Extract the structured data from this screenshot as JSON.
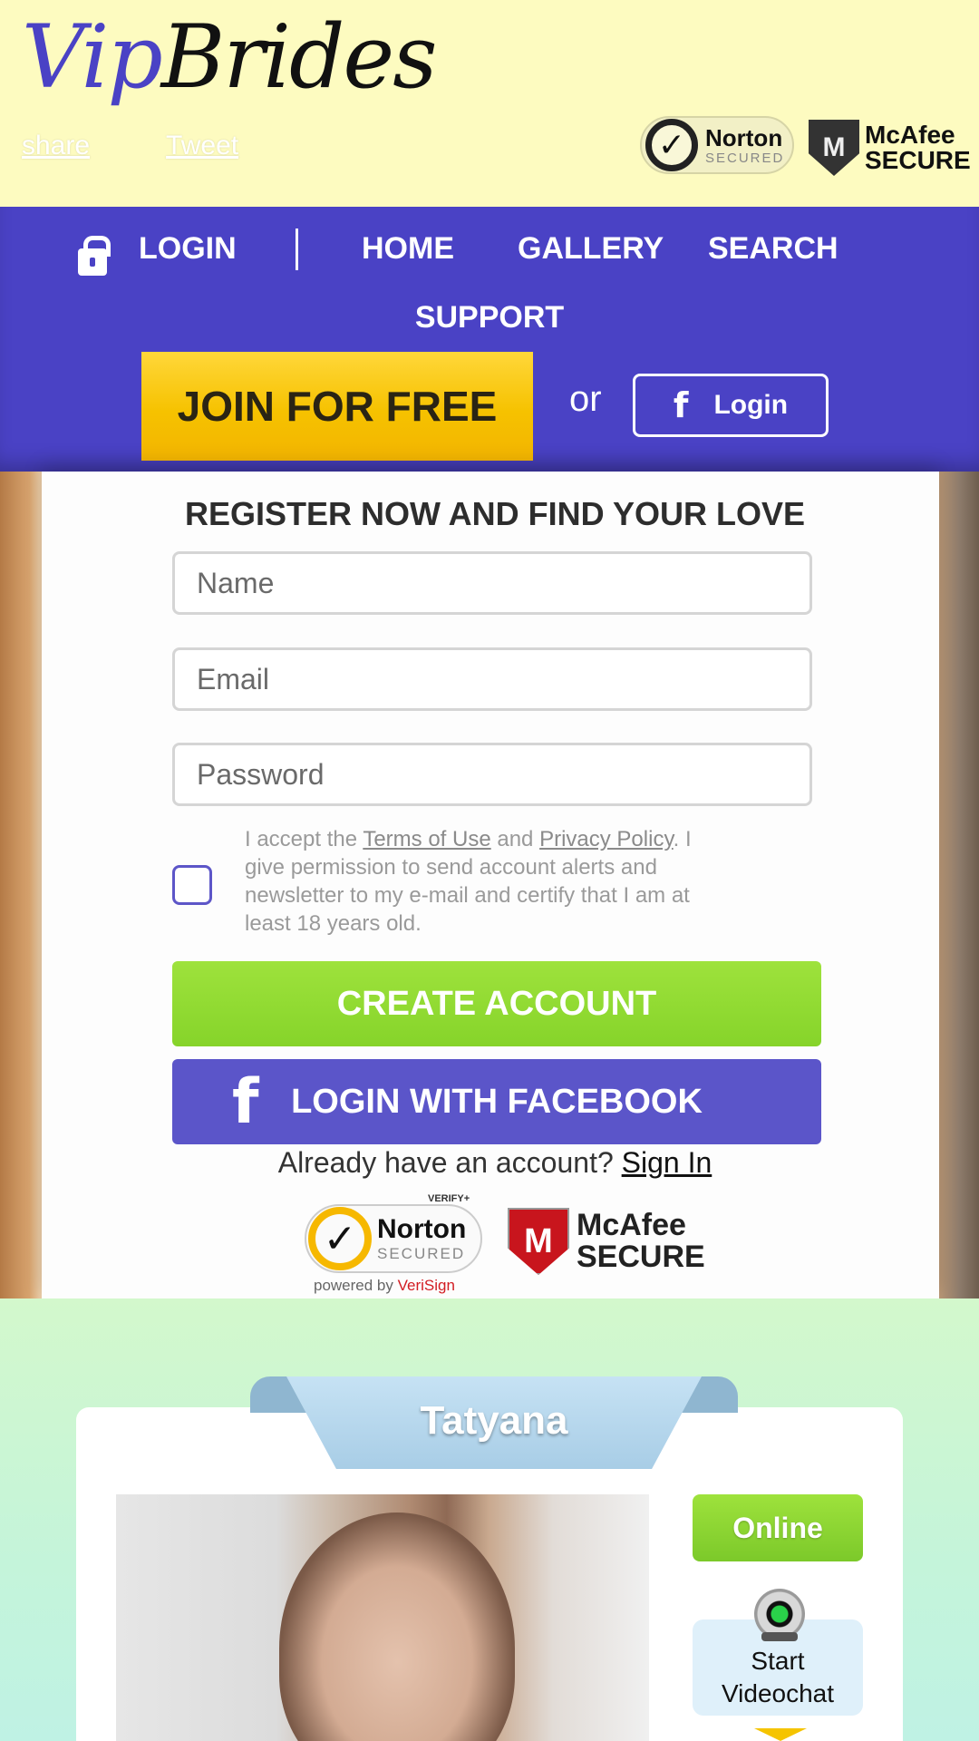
{
  "header": {
    "logo_part1": "Vip",
    "logo_part2": "Brides",
    "share_label": "share",
    "tweet_label": "Tweet",
    "norton_badge": {
      "line1": "Norton",
      "line2": "SECURED"
    },
    "mcafee_badge": {
      "shield": "M",
      "line1": "McAfee",
      "line2": "SECURE"
    }
  },
  "nav": {
    "login": "LOGIN",
    "home": "HOME",
    "gallery": "GALLERY",
    "search": "SEARCH",
    "support": "SUPPORT",
    "join_button": "JOIN FOR FREE",
    "or_text": "or",
    "fb_login_icon": "f",
    "fb_login_label": "Login"
  },
  "register": {
    "title": "REGISTER NOW AND FIND YOUR LOVE",
    "name_placeholder": "Name",
    "email_placeholder": "Email",
    "password_placeholder": "Password",
    "terms_prefix": "I accept the ",
    "terms_link": "Terms of Use",
    "terms_and": " and ",
    "privacy_link": "Privacy Policy",
    "terms_suffix": ". I give permission to send account alerts and newsletter to my e-mail and certify that I am at least 18 years old.",
    "create_button": "CREATE ACCOUNT",
    "facebook_icon": "f",
    "facebook_button": "LOGIN WITH FACEBOOK",
    "already_text": "Already have an account? ",
    "sign_in_link": "Sign In",
    "norton_badge": {
      "verify": "VERIFY+",
      "line1": "Norton",
      "line2": "SECURED",
      "powered": "powered by ",
      "powered_brand": "VeriSign"
    },
    "mcafee_badge": {
      "shield": "M",
      "line1": "McAfee",
      "line2": "SECURE"
    }
  },
  "profile": {
    "name": "Tatyana",
    "online_label": "Online",
    "videochat_line1": "Start",
    "videochat_line2": "Videochat"
  },
  "colors": {
    "header_bg": "#fdfbc0",
    "nav_bg": "#4a42c5",
    "join_yellow": "#f6c200",
    "create_green": "#8fd830",
    "facebook_purple": "#5b55c9"
  }
}
